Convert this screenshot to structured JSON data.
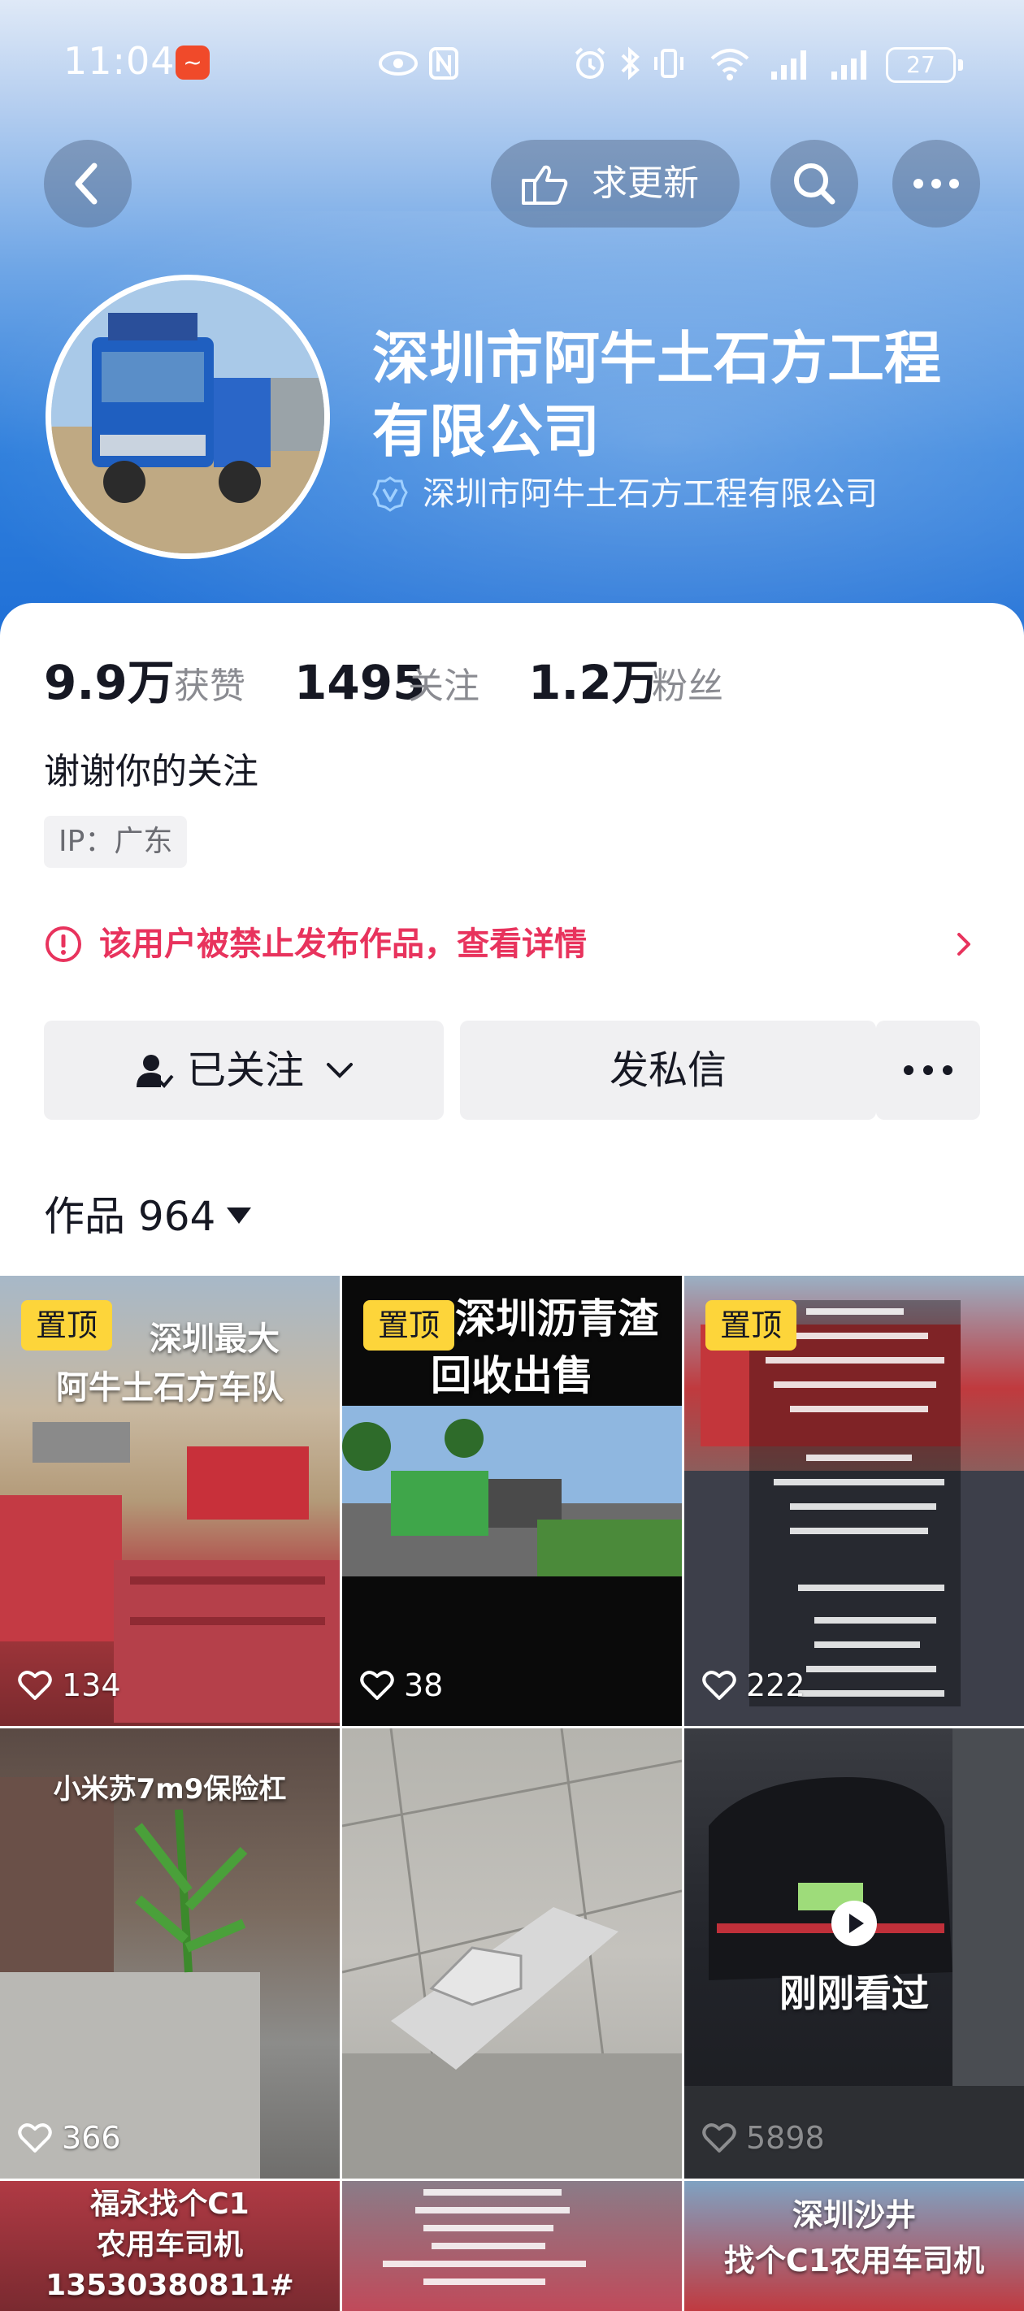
{
  "status_bar": {
    "time": "11:04",
    "battery": "27"
  },
  "nav": {
    "request_update_label": "求更新"
  },
  "profile": {
    "name": "深圳市阿牛土石方工程有限公司",
    "verified_text": "深圳市阿牛土石方工程有限公司",
    "bio": "谢谢你的关注",
    "ip_location": "IP：广东"
  },
  "stats": [
    {
      "value": "9.9万",
      "label": "获赞"
    },
    {
      "value": "1495",
      "label": "关注"
    },
    {
      "value": "1.2万",
      "label": "粉丝"
    }
  ],
  "notice": {
    "text": "该用户被禁止发布作品，查看详情",
    "color": "#e8335d"
  },
  "actions": {
    "follow_label": "已关注",
    "message_label": "发私信"
  },
  "works": {
    "label": "作品 964"
  },
  "videos": [
    {
      "pinned": true,
      "pin_label": "置顶",
      "caption": [
        "深圳最大",
        "阿牛土石方车队"
      ],
      "likes": "134"
    },
    {
      "pinned": true,
      "pin_label": "置顶",
      "caption": [
        "深圳沥青渣",
        "回收出售"
      ],
      "likes": "38"
    },
    {
      "pinned": true,
      "pin_label": "置顶",
      "caption": [],
      "likes": "222"
    },
    {
      "pinned": false,
      "caption": [
        "小米苏7m9保险杠"
      ],
      "likes": "366"
    },
    {
      "pinned": false,
      "caption": [],
      "likes": ""
    },
    {
      "pinned": false,
      "caption": [],
      "likes": "5898",
      "watched_label": "刚刚看过"
    },
    {
      "pinned": false,
      "caption": [
        "福永找个C1",
        "农用车司机",
        "13530380811#"
      ],
      "likes": ""
    },
    {
      "pinned": false,
      "caption": [],
      "likes": ""
    },
    {
      "pinned": false,
      "caption": [
        "深圳沙井",
        "找个C1农用车司机"
      ],
      "likes": ""
    }
  ],
  "colors": {
    "accent_red": "#e8335d",
    "pin_yellow": "#fdd53a",
    "banner_blue": "#2f7fdc"
  }
}
